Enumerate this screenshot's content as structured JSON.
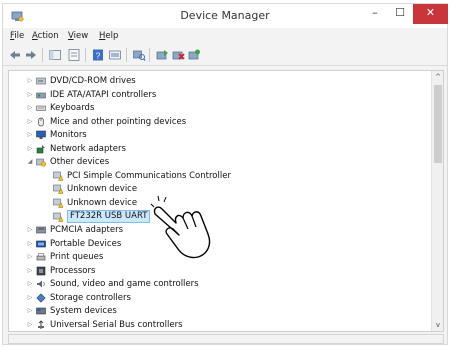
{
  "window": {
    "title": "Device Manager"
  },
  "titlebar": {
    "minimize_label": "–",
    "maximize_label": "☐",
    "close_label": "✕"
  },
  "menu": [
    {
      "label": "File",
      "underline": "F",
      "rest": "ile"
    },
    {
      "label": "Action",
      "underline": "A",
      "rest": "ction"
    },
    {
      "label": "View",
      "underline": "V",
      "rest": "iew"
    },
    {
      "label": "Help",
      "underline": "H",
      "rest": "elp"
    }
  ],
  "tree": {
    "items": [
      {
        "label": "DVD/CD-ROM drives",
        "level": 1,
        "expander": "▷",
        "icon": "dvd-drive-icon"
      },
      {
        "label": "IDE ATA/ATAPI controllers",
        "level": 1,
        "expander": "▷",
        "icon": "ide-controller-icon"
      },
      {
        "label": "Keyboards",
        "level": 1,
        "expander": "▷",
        "icon": "keyboard-icon"
      },
      {
        "label": "Mice and other pointing devices",
        "level": 1,
        "expander": "▷",
        "icon": "mouse-icon"
      },
      {
        "label": "Monitors",
        "level": 1,
        "expander": "▷",
        "icon": "monitor-icon"
      },
      {
        "label": "Network adapters",
        "level": 1,
        "expander": "▷",
        "icon": "network-adapter-icon"
      },
      {
        "label": "Other devices",
        "level": 1,
        "expander": "◢",
        "icon": "other-devices-icon"
      },
      {
        "label": "PCI Simple Communications Controller",
        "level": 2,
        "expander": "",
        "icon": "unknown-device-warning-icon"
      },
      {
        "label": "Unknown device",
        "level": 2,
        "expander": "",
        "icon": "unknown-device-warning-icon"
      },
      {
        "label": "Unknown device",
        "level": 2,
        "expander": "",
        "icon": "unknown-device-warning-icon"
      },
      {
        "label": "FT232R USB UART",
        "level": 2,
        "expander": "",
        "icon": "unknown-device-warning-icon",
        "selected": true
      },
      {
        "label": "PCMCIA adapters",
        "level": 1,
        "expander": "▷",
        "icon": "pcmcia-adapter-icon"
      },
      {
        "label": "Portable Devices",
        "level": 1,
        "expander": "▷",
        "icon": "portable-device-icon"
      },
      {
        "label": "Print queues",
        "level": 1,
        "expander": "▷",
        "icon": "printer-icon"
      },
      {
        "label": "Processors",
        "level": 1,
        "expander": "▷",
        "icon": "processor-icon"
      },
      {
        "label": "Sound, video and game controllers",
        "level": 1,
        "expander": "▷",
        "icon": "sound-icon"
      },
      {
        "label": "Storage controllers",
        "level": 1,
        "expander": "▷",
        "icon": "storage-controller-icon"
      },
      {
        "label": "System devices",
        "level": 1,
        "expander": "▷",
        "icon": "system-device-icon"
      },
      {
        "label": "Universal Serial Bus controllers",
        "level": 1,
        "expander": "▷",
        "icon": "usb-icon"
      }
    ]
  },
  "scrollbar": {
    "up_arrow": "^",
    "down_arrow": "v"
  },
  "colors": {
    "close_button": "#c8353a",
    "selection_bg": "#cce8ff",
    "selection_border": "#7fbde8",
    "warning_yellow": "#f2c230"
  }
}
